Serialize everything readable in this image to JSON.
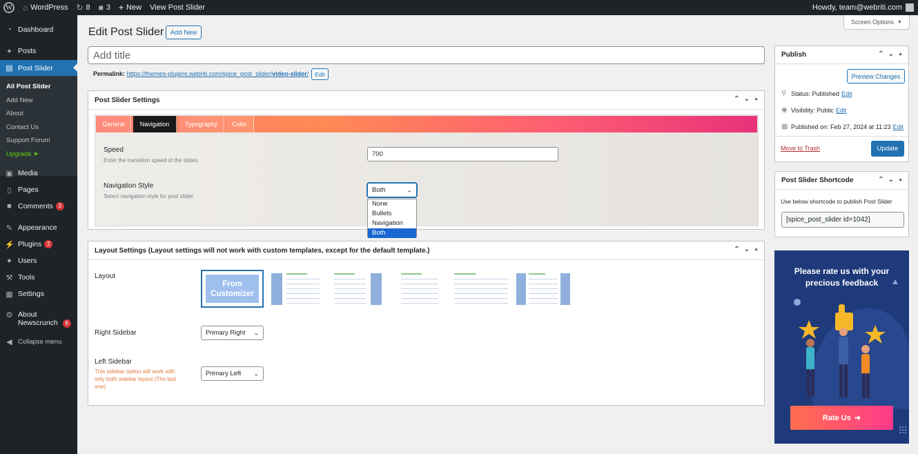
{
  "adminbar": {
    "site_name": "WordPress",
    "updates_count": "8",
    "comments_count": "3",
    "new_label": "New",
    "view_label": "View Post Slider",
    "howdy": "Howdy, team@webriti.com"
  },
  "sidebar": {
    "dashboard": "Dashboard",
    "posts": "Posts",
    "post_slider": "Post Slider",
    "submenu": {
      "all": "All Post Slider",
      "add_new": "Add New",
      "about": "About",
      "contact": "Contact Us",
      "support": "Support Forum",
      "upgrade": "Upgrade"
    },
    "media": "Media",
    "pages": "Pages",
    "comments": "Comments",
    "comments_badge": "3",
    "appearance": "Appearance",
    "plugins": "Plugins",
    "plugins_badge": "2",
    "users": "Users",
    "tools": "Tools",
    "settings": "Settings",
    "about_newscrunch_1": "About",
    "about_newscrunch_2": "Newscrunch",
    "newscrunch_badge": "6",
    "collapse": "Collapse menu"
  },
  "header": {
    "title": "Edit Post Slider",
    "add_new": "Add New",
    "screen_options": "Screen Options"
  },
  "title_field": {
    "placeholder": "Add title"
  },
  "permalink": {
    "label": "Permalink:",
    "url_base": "https://themes-plugins.webriti.com/spice_post_slider/",
    "slug": "video-slider",
    "url_end": "/",
    "edit": "Edit"
  },
  "slider_settings": {
    "title": "Post Slider Settings",
    "tabs": [
      "General",
      "Navigation",
      "Typography",
      "Color"
    ],
    "speed_label": "Speed",
    "speed_desc": "Enter the transition speed of the slides.",
    "speed_value": "700",
    "nav_label": "Navigation Style",
    "nav_desc": "Select navigation style for post slider.",
    "nav_selected": "Both",
    "nav_options": [
      "None",
      "Bullets",
      "Navigation",
      "Both"
    ]
  },
  "layout_settings": {
    "title": "Layout Settings (Layout settings will not work with custom templates, except for the default template.)",
    "layout_label": "Layout",
    "from_customizer": "From Customizer",
    "right_sidebar_label": "Right Sidebar",
    "right_sidebar_value": "Primary Right",
    "left_sidebar_label": "Left Sidebar",
    "left_sidebar_desc": "This sidebar option will work with only both sidebar layout (The last one)",
    "left_sidebar_value": "Primary Left"
  },
  "publish": {
    "title": "Publish",
    "preview": "Preview Changes",
    "status_label": "Status:",
    "status_value": "Published",
    "visibility_label": "Visibility:",
    "visibility_value": "Public",
    "published_label": "Published on:",
    "published_value": "Feb 27, 2024 at 11:23",
    "edit": "Edit",
    "trash": "Move to Trash",
    "update": "Update"
  },
  "shortcode": {
    "title": "Post Slider Shortcode",
    "desc": "Use below shortcode to publish Post Slider",
    "value": "[spice_post_slider id=1042]"
  },
  "rate": {
    "line1": "Please rate us with your",
    "line2": "precious feedback",
    "button": "Rate Us"
  },
  "colors": {
    "admin_dark": "#1d2327",
    "accent": "#2271b1",
    "badge": "#d63638",
    "upgrade": "#5ed30d",
    "banner": "#1e3a7b"
  },
  "icons": {
    "dashboard": "gauge-icon",
    "posts": "pushpin-icon",
    "media": "media-icon",
    "pages": "pages-icon",
    "comments": "speech-bubble-icon",
    "appearance": "paintbrush-icon",
    "plugins": "plug-icon",
    "users": "user-icon",
    "tools": "wrench-icon",
    "settings": "sliders-icon",
    "collapse": "collapse-arrow-icon"
  }
}
